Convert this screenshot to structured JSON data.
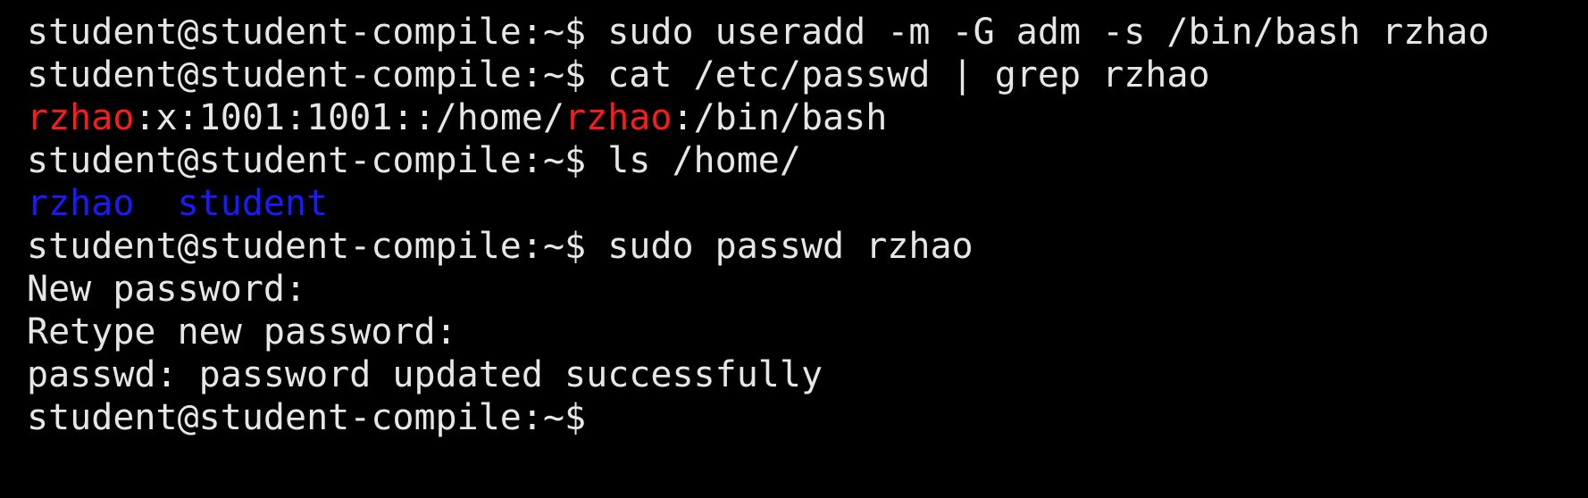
{
  "colors": {
    "background": "#000000",
    "foreground": "#e6e6e6",
    "highlight_red": "#ff1a1a",
    "directory_blue": "#1a1aff"
  },
  "terminal": {
    "prompt": "student@student-compile:~$",
    "line1": {
      "command": " sudo useradd -m -G adm -s /bin/bash rzhao"
    },
    "line2": {
      "command": " cat /etc/passwd | grep rzhao"
    },
    "line3": {
      "match1": "rzhao",
      "mid": ":x:1001:1001::/home/",
      "match2": "rzhao",
      "tail": ":/bin/bash"
    },
    "line4": {
      "command": " ls /home/"
    },
    "line5": {
      "dir1": "rzhao",
      "sep": "  ",
      "dir2": "student"
    },
    "line6": {
      "command": " sudo passwd rzhao"
    },
    "line7": {
      "text": "New password:"
    },
    "line8": {
      "text": "Retype new password:"
    },
    "line9": {
      "text": "passwd: password updated successfully"
    }
  }
}
